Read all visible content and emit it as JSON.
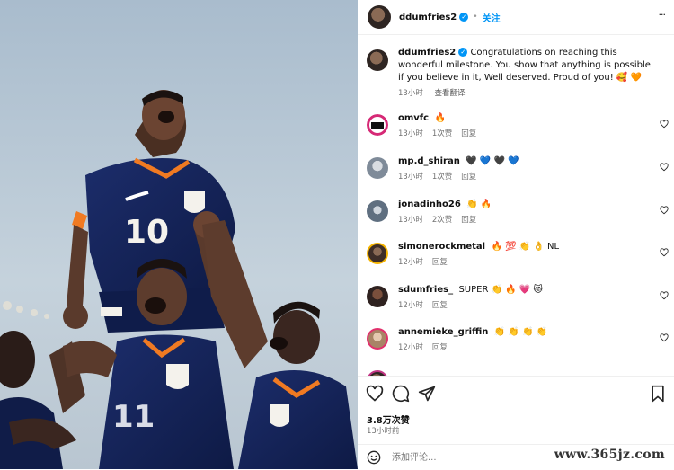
{
  "post": {
    "username": "ddumfries2",
    "follow_label": "关注",
    "more_label": "···"
  },
  "caption": {
    "username": "ddumfries2",
    "text": "Congratulations on reaching this wonderful milestone. You show that anything is possible if you believe in it, Well deserved. Proud of you! 🥰 🧡",
    "time": "13小时",
    "translate_label": "查看翻译"
  },
  "comments": [
    {
      "username": "omvfc",
      "text": "🔥",
      "time": "13小时",
      "likes": "1次赞",
      "reply": "回复",
      "avatar_color": "#ffffff"
    },
    {
      "username": "mp.d_shiran",
      "text": "🖤 💙 🖤 💙",
      "time": "13小时",
      "likes": "1次赞",
      "reply": "回复",
      "avatar_color": "#8a97a8"
    },
    {
      "username": "jonadinho26",
      "text": "👏 🔥",
      "time": "13小时",
      "likes": "2次赞",
      "reply": "回复",
      "avatar_color": "#6b7b8c"
    },
    {
      "username": "simonerockmetal",
      "text": "🔥 💯 👏 👌 NL",
      "time": "12小时",
      "likes": "",
      "reply": "回复",
      "avatar_color": "#5a4a42"
    },
    {
      "username": "sdumfries_",
      "text": "SUPER 👏 🔥 💗 😻",
      "time": "12小时",
      "likes": "",
      "reply": "回复",
      "avatar_color": "#4a3a35"
    },
    {
      "username": "annemieke_griffin",
      "text": "👏 👏 👏 👏",
      "time": "12小时",
      "likes": "",
      "reply": "回复",
      "avatar_color": "#c9a58a"
    }
  ],
  "partial_comment": "",
  "likes_count": "3.8万次赞",
  "post_time": "13小时前",
  "footer": {
    "comment_placeholder": "添加评论...",
    "emoji_icon": "smiley-icon"
  },
  "watermark": "www.365jz.com",
  "photo": {
    "jersey_number_top": "10",
    "jersey_number_bottom": "11"
  }
}
